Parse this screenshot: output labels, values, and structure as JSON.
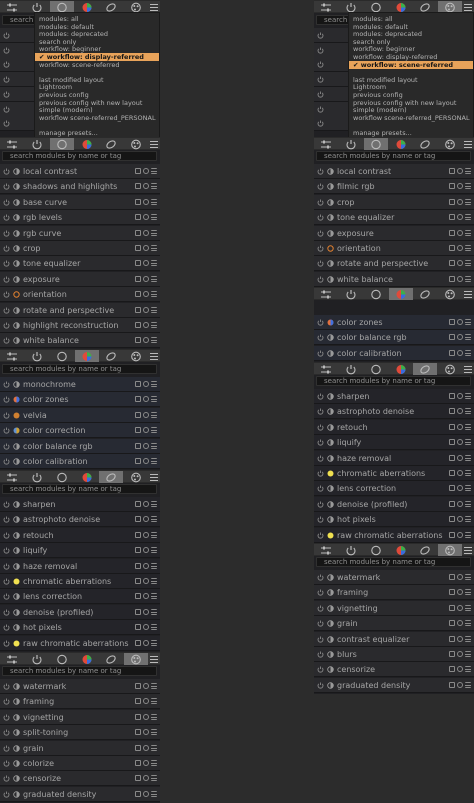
{
  "left_panel": {
    "search_placeholder": "search modules by name or tag",
    "top_search_fragment": "search",
    "active_tab_index": 2,
    "dropdown": {
      "items": [
        "modules: all",
        "modules: default",
        "modules: deprecated",
        "search only",
        "workflow: beginner",
        "workflow: display-referred",
        "workflow: scene-referred",
        "",
        "last modified layout",
        "Lightroom",
        "previous config",
        "previous config with new layout",
        "simple (modern)",
        "workflow scene-referred_PERSONAL",
        "",
        "manage presets..."
      ],
      "selected_index": 5,
      "selected_mark": "✔"
    },
    "groups": [
      {
        "active_tab_index": 2,
        "search_placeholder": "search modules by name or tag",
        "tint": "g1",
        "modules": [
          {
            "label": "local contrast",
            "icon": "contrast-icon"
          },
          {
            "label": "shadows and highlights",
            "icon": "shadows-icon"
          },
          {
            "label": "base curve",
            "icon": "curve-icon"
          },
          {
            "label": "rgb levels",
            "icon": "levels-icon"
          },
          {
            "label": "rgb curve",
            "icon": "curve-icon"
          },
          {
            "label": "crop",
            "icon": "crop-icon"
          },
          {
            "label": "tone equalizer",
            "icon": "tone-icon"
          },
          {
            "label": "exposure",
            "icon": "exposure-icon"
          },
          {
            "label": "orientation",
            "icon": "orientation-icon"
          },
          {
            "label": "rotate and perspective",
            "icon": "perspective-icon"
          },
          {
            "label": "highlight reconstruction",
            "icon": "highlight-icon"
          },
          {
            "label": "white balance",
            "icon": "whitebalance-icon"
          }
        ]
      },
      {
        "active_tab_index": 3,
        "search_placeholder": "search modules by name or tag",
        "tint": "g2",
        "modules": [
          {
            "label": "monochrome",
            "icon": "monochrome-icon"
          },
          {
            "label": "color zones",
            "icon": "colorzones-icon"
          },
          {
            "label": "velvia",
            "icon": "velvia-icon"
          },
          {
            "label": "color correction",
            "icon": "colorcorrection-icon"
          },
          {
            "label": "color balance rgb",
            "icon": "colorbalance-icon"
          },
          {
            "label": "color calibration",
            "icon": "calibration-icon"
          }
        ]
      },
      {
        "active_tab_index": 4,
        "search_placeholder": "search modules by name or tag",
        "tint": "g3",
        "modules": [
          {
            "label": "sharpen",
            "icon": "sharpen-icon"
          },
          {
            "label": "astrophoto denoise",
            "icon": "denoise-icon"
          },
          {
            "label": "retouch",
            "icon": "retouch-icon"
          },
          {
            "label": "liquify",
            "icon": "liquify-icon"
          },
          {
            "label": "haze removal",
            "icon": "haze-icon"
          },
          {
            "label": "chromatic aberrations",
            "icon": "chromatic-icon"
          },
          {
            "label": "lens correction",
            "icon": "lens-icon"
          },
          {
            "label": "denoise (profiled)",
            "icon": "denoise-icon"
          },
          {
            "label": "hot pixels",
            "icon": "hotpixels-icon"
          },
          {
            "label": "raw chromatic aberrations",
            "icon": "chromatic-icon"
          }
        ]
      },
      {
        "active_tab_index": 5,
        "search_placeholder": "search modules by name or tag",
        "tint": "g1",
        "modules": [
          {
            "label": "watermark",
            "icon": "watermark-icon"
          },
          {
            "label": "framing",
            "icon": "framing-icon"
          },
          {
            "label": "vignetting",
            "icon": "vignetting-icon"
          },
          {
            "label": "split-toning",
            "icon": "splittoning-icon"
          },
          {
            "label": "grain",
            "icon": "grain-icon"
          },
          {
            "label": "colorize",
            "icon": "colorize-icon"
          },
          {
            "label": "censorize",
            "icon": "censorize-icon"
          },
          {
            "label": "graduated density",
            "icon": "graduated-icon"
          }
        ]
      }
    ]
  },
  "right_panel": {
    "top_search_fragment": "search",
    "active_tab_index": 5,
    "dropdown": {
      "items": [
        "modules: all",
        "modules: default",
        "modules: deprecated",
        "search only",
        "workflow: beginner",
        "workflow: display-referred",
        "workflow: scene-referred",
        "",
        "last modified layout",
        "Lightroom",
        "previous config",
        "previous config with new layout",
        "simple (modern)",
        "workflow scene-referred_PERSONAL",
        "",
        "manage presets..."
      ],
      "selected_index": 6,
      "selected_mark": "✔"
    },
    "groups": [
      {
        "active_tab_index": 2,
        "search_placeholder": "search modules by name or tag",
        "tint": "g1",
        "modules": [
          {
            "label": "local contrast",
            "icon": "contrast-icon"
          },
          {
            "label": "filmic rgb",
            "icon": "filmic-icon"
          },
          {
            "label": "crop",
            "icon": "crop-icon"
          },
          {
            "label": "tone equalizer",
            "icon": "tone-icon"
          },
          {
            "label": "exposure",
            "icon": "exposure-icon"
          },
          {
            "label": "orientation",
            "icon": "orientation-icon"
          },
          {
            "label": "rotate and perspective",
            "icon": "perspective-icon"
          },
          {
            "label": "white balance",
            "icon": "whitebalance-icon"
          }
        ]
      },
      {
        "active_tab_index": 3,
        "search_placeholder": "",
        "tint": "g2",
        "modules": [
          {
            "label": "color zones",
            "icon": "colorzones-icon"
          },
          {
            "label": "color balance rgb",
            "icon": "colorbalance-icon"
          },
          {
            "label": "color calibration",
            "icon": "calibration-icon"
          }
        ]
      },
      {
        "active_tab_index": 4,
        "search_placeholder": "search modules by name or tag",
        "tint": "g3",
        "modules": [
          {
            "label": "sharpen",
            "icon": "sharpen-icon"
          },
          {
            "label": "astrophoto denoise",
            "icon": "denoise-icon"
          },
          {
            "label": "retouch",
            "icon": "retouch-icon"
          },
          {
            "label": "liquify",
            "icon": "liquify-icon"
          },
          {
            "label": "haze removal",
            "icon": "haze-icon"
          },
          {
            "label": "chromatic aberrations",
            "icon": "chromatic-icon"
          },
          {
            "label": "lens correction",
            "icon": "lens-icon"
          },
          {
            "label": "denoise (profiled)",
            "icon": "denoise-icon"
          },
          {
            "label": "hot pixels",
            "icon": "hotpixels-icon"
          },
          {
            "label": "raw chromatic aberrations",
            "icon": "chromatic-icon"
          }
        ]
      },
      {
        "active_tab_index": 5,
        "search_placeholder": "search modules by name or tag",
        "tint": "g1",
        "modules": [
          {
            "label": "watermark",
            "icon": "watermark-icon"
          },
          {
            "label": "framing",
            "icon": "framing-icon"
          },
          {
            "label": "vignetting",
            "icon": "vignetting-icon"
          },
          {
            "label": "grain",
            "icon": "grain-icon"
          },
          {
            "label": "contrast equalizer",
            "icon": "equalizer-icon"
          },
          {
            "label": "blurs",
            "icon": "blurs-icon"
          },
          {
            "label": "censorize",
            "icon": "censorize-icon"
          },
          {
            "label": "graduated density",
            "icon": "graduated-icon"
          }
        ]
      }
    ]
  },
  "tabs": [
    {
      "name": "presets-icon"
    },
    {
      "name": "active-modules-icon"
    },
    {
      "name": "base-group-icon"
    },
    {
      "name": "color-group-icon"
    },
    {
      "name": "correct-group-icon"
    },
    {
      "name": "effect-group-icon"
    },
    {
      "name": "menu-icon"
    }
  ],
  "colors": {
    "accent": "#e8a35a",
    "active_tab": "#707070",
    "panel": "#202023"
  }
}
